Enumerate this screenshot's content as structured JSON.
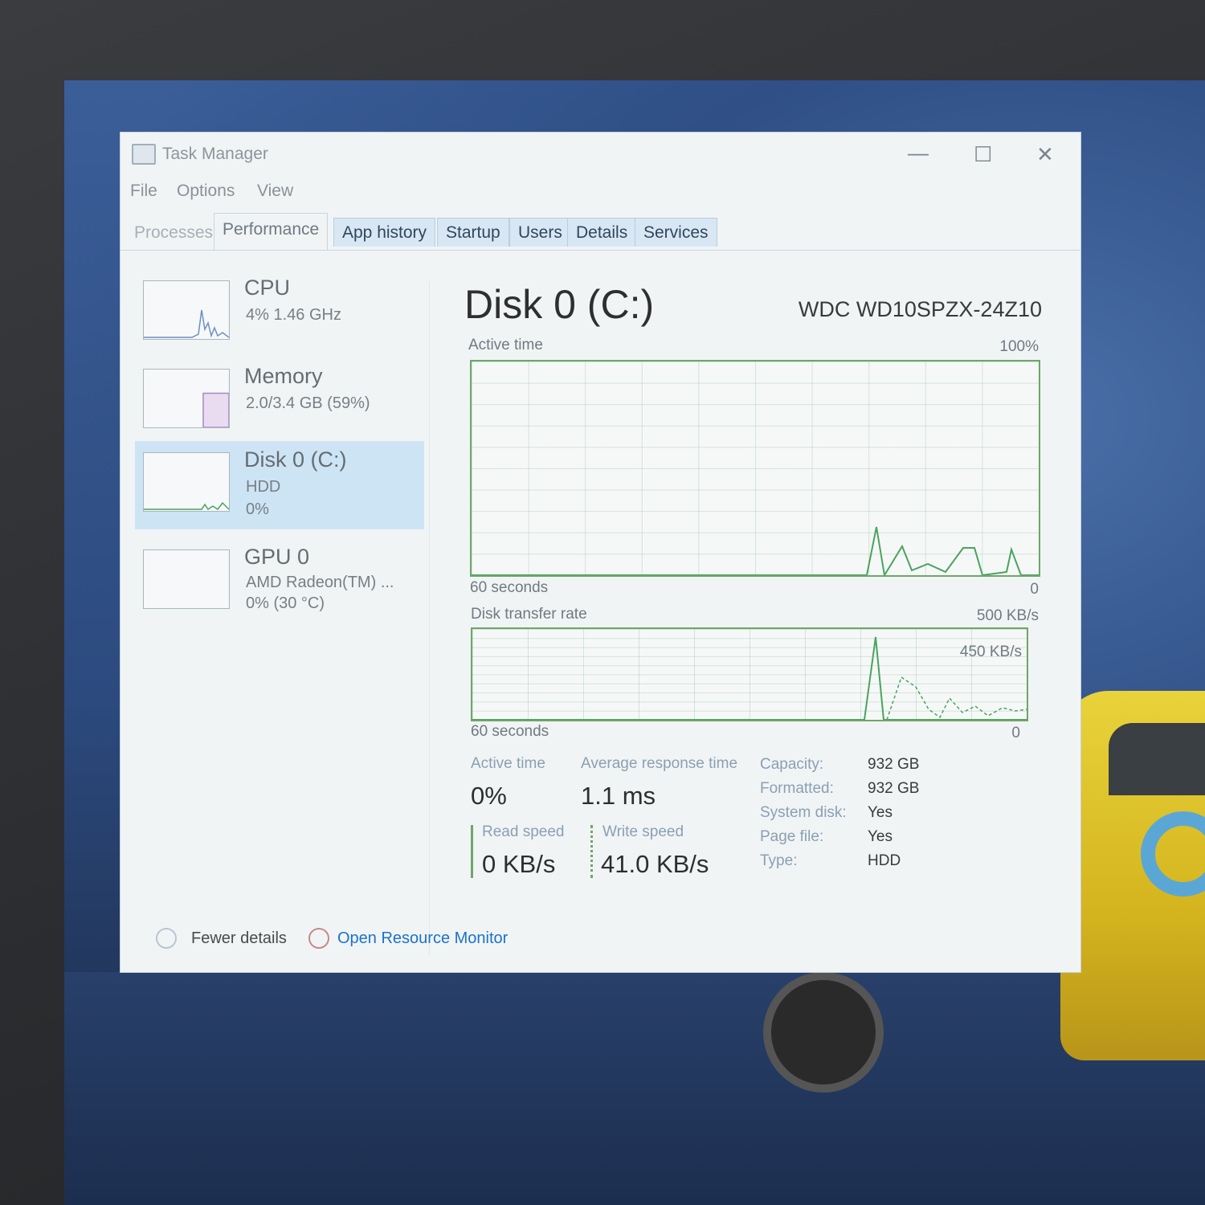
{
  "window": {
    "title": "Task Manager",
    "controls": {
      "minimize": "—",
      "maximize": "☐",
      "close": "✕"
    }
  },
  "menu": [
    "File",
    "Options",
    "View"
  ],
  "tabs": [
    "Processes",
    "Performance",
    "App history",
    "Startup",
    "Users",
    "Details",
    "Services"
  ],
  "sidebar": {
    "cpu": {
      "title": "CPU",
      "sub1": "4% 1.46 GHz"
    },
    "memory": {
      "title": "Memory",
      "sub1": "2.0/3.4 GB (59%)",
      "used_fraction": 0.59
    },
    "disk": {
      "title": "Disk 0 (C:)",
      "sub1": "HDD",
      "sub2": "0%"
    },
    "gpu": {
      "title": "GPU 0",
      "sub1": "AMD Radeon(TM) ...",
      "sub2": "0% (30 °C)"
    }
  },
  "main": {
    "title": "Disk 0 (C:)",
    "model": "WDC WD10SPZX-24Z10",
    "active_graph": {
      "label": "Active time",
      "max_label": "100%",
      "time_label": "60 seconds",
      "min_label": "0"
    },
    "transfer_graph": {
      "label": "Disk transfer rate",
      "max_label": "500 KB/s",
      "peak_label": "450 KB/s",
      "time_label": "60 seconds",
      "min_label": "0"
    },
    "stats": {
      "active_time": {
        "label": "Active time",
        "value": "0%"
      },
      "avg_response": {
        "label": "Average response time",
        "value": "1.1 ms"
      },
      "read_speed": {
        "label": "Read speed",
        "value": "0 KB/s"
      },
      "write_speed": {
        "label": "Write speed",
        "value": "41.0 KB/s"
      }
    },
    "properties": [
      {
        "label": "Capacity:",
        "value": "932 GB"
      },
      {
        "label": "Formatted:",
        "value": "932 GB"
      },
      {
        "label": "System disk:",
        "value": "Yes"
      },
      {
        "label": "Page file:",
        "value": "Yes"
      },
      {
        "label": "Type:",
        "value": "HDD"
      }
    ]
  },
  "footer": {
    "fewer_details": "Fewer details",
    "open_resource_monitor": "Open Resource Monitor"
  },
  "colors": {
    "graph_line": "#4aa35f",
    "selected_item": "#cde4f5",
    "link": "#1a73c9"
  }
}
